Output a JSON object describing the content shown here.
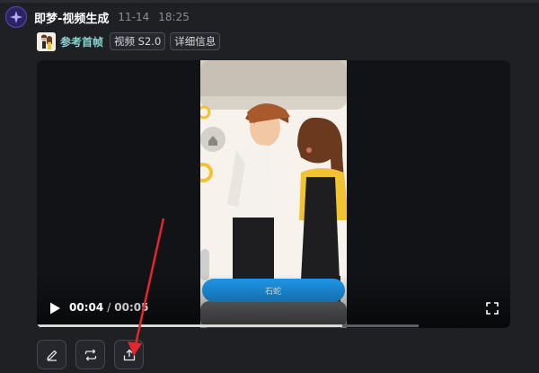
{
  "header": {
    "app_name": "即梦-视频生成",
    "date": "11-14",
    "time": "18:25"
  },
  "tags": {
    "reference_label": "参考首帧",
    "model_chip": "视频 S2.0",
    "details_chip": "详细信息"
  },
  "player": {
    "current_time": "00:04",
    "separator": "/",
    "duration": "00:05",
    "progress_fraction": 0.8,
    "in_video_button_label": "石蛇"
  },
  "actions": [
    {
      "name": "edit-icon"
    },
    {
      "name": "regenerate-icon"
    },
    {
      "name": "upload-icon"
    }
  ],
  "colors": {
    "background": "#1f2024",
    "accent_logo": "#6a55e0",
    "reference_text": "#8ad4d0",
    "annotation_arrow": "#e0282e",
    "in_video_button": "#1e9bf0"
  }
}
